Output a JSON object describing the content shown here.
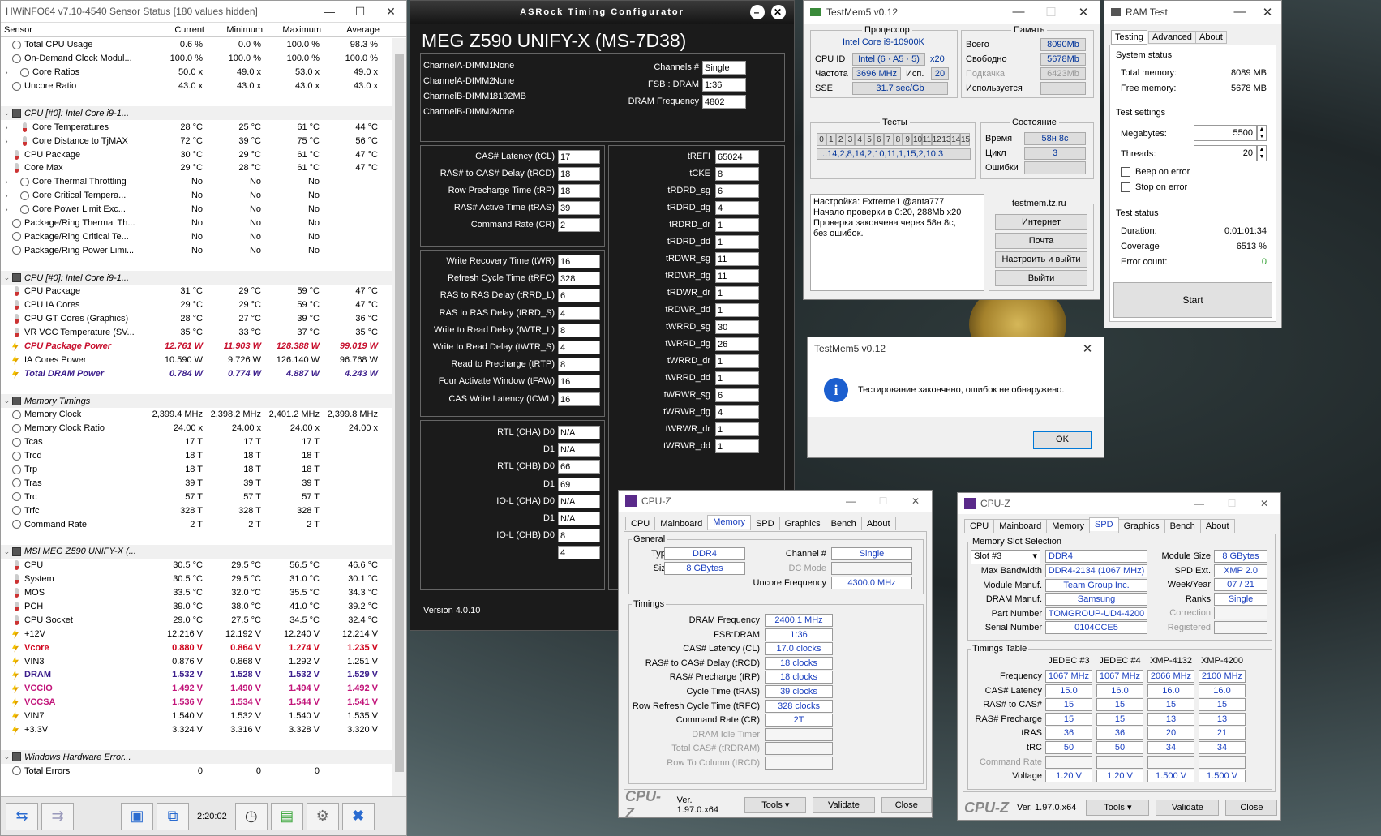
{
  "hwinfo": {
    "title": "HWiNFO64 v7.10-4540 Sensor Status [180 values hidden]",
    "headers": [
      "Sensor",
      "Current",
      "Minimum",
      "Maximum",
      "Average"
    ],
    "rows": [
      {
        "t": "c",
        "n": "Total CPU Usage",
        "v": [
          "0.6 %",
          "0.0 %",
          "100.0 %",
          "98.3 %"
        ]
      },
      {
        "t": "c",
        "n": "On-Demand Clock Modul...",
        "v": [
          "100.0 %",
          "100.0 %",
          "100.0 %",
          "100.0 %"
        ]
      },
      {
        "t": "c",
        "x": "›",
        "n": "Core Ratios",
        "v": [
          "50.0 x",
          "49.0 x",
          "53.0 x",
          "49.0 x"
        ],
        "ind": 1
      },
      {
        "t": "c",
        "n": "Uncore Ratio",
        "v": [
          "43.0 x",
          "43.0 x",
          "43.0 x",
          "43.0 x"
        ]
      },
      {
        "t": "blank"
      },
      {
        "t": "g",
        "x": "⌄",
        "n": "CPU [#0]: Intel Core i9-1..."
      },
      {
        "t": "th",
        "x": "›",
        "n": "Core Temperatures",
        "v": [
          "28 °C",
          "25 °C",
          "61 °C",
          "44 °C"
        ],
        "ind": 1
      },
      {
        "t": "th",
        "x": "›",
        "n": "Core Distance to TjMAX",
        "v": [
          "72 °C",
          "39 °C",
          "75 °C",
          "56 °C"
        ],
        "ind": 1
      },
      {
        "t": "th",
        "n": "CPU Package",
        "v": [
          "30 °C",
          "29 °C",
          "61 °C",
          "47 °C"
        ]
      },
      {
        "t": "th",
        "n": "Core Max",
        "v": [
          "29 °C",
          "28 °C",
          "61 °C",
          "47 °C"
        ]
      },
      {
        "t": "c",
        "x": "›",
        "n": "Core Thermal Throttling",
        "v": [
          "No",
          "No",
          "No",
          ""
        ],
        "ind": 1
      },
      {
        "t": "c",
        "x": "›",
        "n": "Core Critical Tempera...",
        "v": [
          "No",
          "No",
          "No",
          ""
        ],
        "ind": 1
      },
      {
        "t": "c",
        "x": "›",
        "n": "Core Power Limit Exc...",
        "v": [
          "No",
          "No",
          "No",
          ""
        ],
        "ind": 1
      },
      {
        "t": "c",
        "n": "Package/Ring Thermal Th...",
        "v": [
          "No",
          "No",
          "No",
          ""
        ]
      },
      {
        "t": "c",
        "n": "Package/Ring Critical Te...",
        "v": [
          "No",
          "No",
          "No",
          ""
        ]
      },
      {
        "t": "c",
        "n": "Package/Ring Power Limi...",
        "v": [
          "No",
          "No",
          "No",
          ""
        ]
      },
      {
        "t": "blank"
      },
      {
        "t": "g",
        "x": "⌄",
        "n": "CPU [#0]: Intel Core i9-1..."
      },
      {
        "t": "th",
        "n": "CPU Package",
        "v": [
          "31 °C",
          "29 °C",
          "59 °C",
          "47 °C"
        ]
      },
      {
        "t": "th",
        "n": "CPU IA Cores",
        "v": [
          "29 °C",
          "29 °C",
          "59 °C",
          "47 °C"
        ]
      },
      {
        "t": "th",
        "n": "CPU GT Cores (Graphics)",
        "v": [
          "28 °C",
          "27 °C",
          "39 °C",
          "36 °C"
        ]
      },
      {
        "t": "th",
        "n": "VR VCC Temperature (SV...",
        "v": [
          "35 °C",
          "33 °C",
          "37 °C",
          "35 °C"
        ]
      },
      {
        "t": "b",
        "cls": "red",
        "n": "CPU Package Power",
        "v": [
          "12.761 W",
          "11.903 W",
          "128.388 W",
          "99.019 W"
        ]
      },
      {
        "t": "b",
        "n": "IA Cores Power",
        "v": [
          "10.590 W",
          "9.726 W",
          "126.140 W",
          "96.768 W"
        ]
      },
      {
        "t": "b",
        "cls": "blue",
        "n": "Total DRAM Power",
        "v": [
          "0.784 W",
          "0.774 W",
          "4.887 W",
          "4.243 W"
        ]
      },
      {
        "t": "blank"
      },
      {
        "t": "g",
        "x": "⌄",
        "n": "Memory Timings"
      },
      {
        "t": "c",
        "n": "Memory Clock",
        "v": [
          "2,399.4 MHz",
          "2,398.2 MHz",
          "2,401.2 MHz",
          "2,399.8 MHz"
        ]
      },
      {
        "t": "c",
        "n": "Memory Clock Ratio",
        "v": [
          "24.00 x",
          "24.00 x",
          "24.00 x",
          "24.00 x"
        ]
      },
      {
        "t": "c",
        "n": "Tcas",
        "v": [
          "17 T",
          "17 T",
          "17 T",
          ""
        ]
      },
      {
        "t": "c",
        "n": "Trcd",
        "v": [
          "18 T",
          "18 T",
          "18 T",
          ""
        ]
      },
      {
        "t": "c",
        "n": "Trp",
        "v": [
          "18 T",
          "18 T",
          "18 T",
          ""
        ]
      },
      {
        "t": "c",
        "n": "Tras",
        "v": [
          "39 T",
          "39 T",
          "39 T",
          ""
        ]
      },
      {
        "t": "c",
        "n": "Trc",
        "v": [
          "57 T",
          "57 T",
          "57 T",
          ""
        ]
      },
      {
        "t": "c",
        "n": "Trfc",
        "v": [
          "328 T",
          "328 T",
          "328 T",
          ""
        ]
      },
      {
        "t": "c",
        "n": "Command Rate",
        "v": [
          "2 T",
          "2 T",
          "2 T",
          ""
        ]
      },
      {
        "t": "blank"
      },
      {
        "t": "g",
        "x": "⌄",
        "n": "MSI MEG Z590 UNIFY-X (..."
      },
      {
        "t": "th",
        "n": "CPU",
        "v": [
          "30.5 °C",
          "29.5 °C",
          "56.5 °C",
          "46.6 °C"
        ]
      },
      {
        "t": "th",
        "n": "System",
        "v": [
          "30.5 °C",
          "29.5 °C",
          "31.0 °C",
          "30.1 °C"
        ]
      },
      {
        "t": "th",
        "n": "MOS",
        "v": [
          "33.5 °C",
          "32.0 °C",
          "35.5 °C",
          "34.3 °C"
        ]
      },
      {
        "t": "th",
        "n": "PCH",
        "v": [
          "39.0 °C",
          "38.0 °C",
          "41.0 °C",
          "39.2 °C"
        ]
      },
      {
        "t": "th",
        "n": "CPU Socket",
        "v": [
          "29.0 °C",
          "27.5 °C",
          "34.5 °C",
          "32.4 °C"
        ]
      },
      {
        "t": "b",
        "n": "+12V",
        "v": [
          "12.216 V",
          "12.192 V",
          "12.240 V",
          "12.214 V"
        ]
      },
      {
        "t": "b",
        "cls": "vred",
        "n": "Vcore",
        "v": [
          "0.880 V",
          "0.864 V",
          "1.274 V",
          "1.235 V"
        ]
      },
      {
        "t": "b",
        "n": "VIN3",
        "v": [
          "0.876 V",
          "0.868 V",
          "1.292 V",
          "1.251 V"
        ]
      },
      {
        "t": "b",
        "cls": "dram",
        "n": "DRAM",
        "v": [
          "1.532 V",
          "1.528 V",
          "1.532 V",
          "1.529 V"
        ]
      },
      {
        "t": "b",
        "cls": "pink",
        "n": "VCCIO",
        "v": [
          "1.492 V",
          "1.490 V",
          "1.494 V",
          "1.492 V"
        ]
      },
      {
        "t": "b",
        "cls": "pink",
        "n": "VCCSA",
        "v": [
          "1.536 V",
          "1.534 V",
          "1.544 V",
          "1.541 V"
        ]
      },
      {
        "t": "b",
        "n": "VIN7",
        "v": [
          "1.540 V",
          "1.532 V",
          "1.540 V",
          "1.535 V"
        ]
      },
      {
        "t": "b",
        "n": "+3.3V",
        "v": [
          "3.324 V",
          "3.316 V",
          "3.328 V",
          "3.320 V"
        ]
      },
      {
        "t": "blank"
      },
      {
        "t": "g",
        "x": "⌄",
        "n": "Windows Hardware Error..."
      },
      {
        "t": "c",
        "n": "Total Errors",
        "v": [
          "0",
          "0",
          "0",
          ""
        ]
      }
    ],
    "time": "2:20:02"
  },
  "asrock": {
    "title": "ASRock Timing Configurator",
    "model": "MEG Z590 UNIFY-X (MS-7D38)",
    "dimms": [
      [
        "ChannelA-DIMM1",
        "None"
      ],
      [
        "ChannelA-DIMM2",
        "None"
      ],
      [
        "ChannelB-DIMM1",
        "8192MB"
      ],
      [
        "ChannelB-DIMM2",
        "None"
      ]
    ],
    "top": [
      [
        "Channels #",
        "Single"
      ],
      [
        "FSB : DRAM",
        "1:36"
      ],
      [
        "DRAM Frequency",
        "4802"
      ]
    ],
    "g1": [
      [
        "CAS# Latency (tCL)",
        "17"
      ],
      [
        "RAS# to CAS# Delay (tRCD)",
        "18"
      ],
      [
        "Row Precharge Time (tRP)",
        "18"
      ],
      [
        "RAS# Active Time (tRAS)",
        "39"
      ],
      [
        "Command Rate (CR)",
        "2"
      ]
    ],
    "g2": [
      [
        "Write Recovery Time (tWR)",
        "16"
      ],
      [
        "Refresh Cycle Time (tRFC)",
        "328"
      ],
      [
        "RAS to RAS Delay (tRRD_L)",
        "6"
      ],
      [
        "RAS to RAS Delay (tRRD_S)",
        "4"
      ],
      [
        "Write to Read Delay (tWTR_L)",
        "8"
      ],
      [
        "Write to Read Delay (tWTR_S)",
        "4"
      ],
      [
        "Read to Precharge (tRTP)",
        "8"
      ],
      [
        "Four Activate Window (tFAW)",
        "16"
      ],
      [
        "CAS Write Latency (tCWL)",
        "16"
      ]
    ],
    "g3": [
      [
        "RTL (CHA) D0",
        "N/A"
      ],
      [
        "D1",
        "N/A"
      ],
      [
        "RTL (CHB) D0",
        "66"
      ],
      [
        "D1",
        "69"
      ],
      [
        "IO-L (CHA) D0",
        "N/A"
      ],
      [
        "D1",
        "N/A"
      ],
      [
        "IO-L (CHB) D0",
        "8"
      ],
      [
        "",
        "4"
      ]
    ],
    "right": [
      [
        "tREFI",
        "65024"
      ],
      [
        "tCKE",
        "8"
      ],
      [
        "tRDRD_sg",
        "6"
      ],
      [
        "tRDRD_dg",
        "4"
      ],
      [
        "tRDRD_dr",
        "1"
      ],
      [
        "tRDRD_dd",
        "1"
      ],
      [
        "tRDWR_sg",
        "11"
      ],
      [
        "tRDWR_dg",
        "11"
      ],
      [
        "tRDWR_dr",
        "1"
      ],
      [
        "tRDWR_dd",
        "1"
      ],
      [
        "tWRRD_sg",
        "30"
      ],
      [
        "tWRRD_dg",
        "26"
      ],
      [
        "tWRRD_dr",
        "1"
      ],
      [
        "tWRRD_dd",
        "1"
      ],
      [
        "tWRWR_sg",
        "6"
      ],
      [
        "tWRWR_dg",
        "4"
      ],
      [
        "tWRWR_dr",
        "1"
      ],
      [
        "tWRWR_dd",
        "1"
      ]
    ],
    "version": "Version 4.0.10"
  },
  "tm5": {
    "title": "TestMem5 v0.12",
    "proc_h": "Процессор",
    "proc": "Intel Core i9-10900K",
    "cpuid_l": "CPU ID",
    "cpuid": "Intel (6 · A5 · 5)",
    "cpuid_x": "x20",
    "freq_l": "Частота",
    "freq": "3696 MHz",
    "isp_l": "Исп.",
    "isp": "20",
    "sse_l": "SSE",
    "sse": "31.7 sec/Gb",
    "mem_h": "Память",
    "mem": [
      [
        "Всего",
        "8090Mb",
        false
      ],
      [
        "Свободно",
        "5678Mb",
        false
      ],
      [
        "Подкачка",
        "6423Mb",
        true
      ],
      [
        "Используется",
        "",
        false
      ]
    ],
    "tests_h": "Тесты",
    "tests": [
      "0",
      "1",
      "2",
      "3",
      "4",
      "5",
      "6",
      "7",
      "8",
      "9",
      "10",
      "11",
      "12",
      "13",
      "14",
      "15"
    ],
    "seq": "...14,2,8,14,2,10,11,1,15,2,10,3",
    "state_h": "Состояние",
    "time_l": "Время",
    "time": "58н 8с",
    "cycle_l": "Цикл",
    "cycle": "3",
    "err_l": "Ошибки",
    "err": "",
    "log": [
      "Настройка: Extreme1 @anta777",
      "Начало проверки в 0:20, 288Mb x20",
      "Проверка закончена через 58н 8с,",
      "без ошибок."
    ],
    "site": "testmem.tz.ru",
    "buttons": [
      "Интернет",
      "Почта",
      "Настроить и выйти",
      "Выйти"
    ]
  },
  "dialog": {
    "title": "TestMem5 v0.12",
    "msg": "Тестирование закончено, ошибок не обнаружено.",
    "ok": "OK"
  },
  "ramtest": {
    "title": "RAM Test",
    "tabs": [
      "Testing",
      "Advanced",
      "About"
    ],
    "sys_h": "System status",
    "total_l": "Total memory:",
    "total": "8089 MB",
    "free_l": "Free memory:",
    "free": "5678 MB",
    "set_h": "Test settings",
    "mb_l": "Megabytes:",
    "mb": "5500",
    "th_l": "Threads:",
    "th": "20",
    "beep": "Beep on error",
    "stop": "Stop on error",
    "st_h": "Test status",
    "dur_l": "Duration:",
    "dur": "0:01:01:34",
    "cov_l": "Coverage",
    "cov": "6513 %",
    "ec_l": "Error count:",
    "ec": "0",
    "start": "Start"
  },
  "cpuz1": {
    "title": "CPU-Z",
    "tabs": [
      "CPU",
      "Mainboard",
      "Memory",
      "SPD",
      "Graphics",
      "Bench",
      "About"
    ],
    "active": 2,
    "general_h": "General",
    "type_l": "Type",
    "type": "DDR4",
    "size_l": "Size",
    "size": "8 GBytes",
    "chan_l": "Channel #",
    "chan": "Single",
    "dc_l": "DC Mode",
    "unc_l": "Uncore Frequency",
    "unc": "4300.0 MHz",
    "tim_h": "Timings",
    "timings": [
      [
        "DRAM Frequency",
        "2400.1 MHz",
        false
      ],
      [
        "FSB:DRAM",
        "1:36",
        false
      ],
      [
        "CAS# Latency (CL)",
        "17.0 clocks",
        false
      ],
      [
        "RAS# to CAS# Delay (tRCD)",
        "18 clocks",
        false
      ],
      [
        "RAS# Precharge (tRP)",
        "18 clocks",
        false
      ],
      [
        "Cycle Time (tRAS)",
        "39 clocks",
        false
      ],
      [
        "Row Refresh Cycle Time (tRFC)",
        "328 clocks",
        false
      ],
      [
        "Command Rate (CR)",
        "2T",
        false
      ],
      [
        "DRAM Idle Timer",
        "",
        true
      ],
      [
        "Total CAS# (tRDRAM)",
        "",
        true
      ],
      [
        "Row To Column (tRCD)",
        "",
        true
      ]
    ],
    "logo": "CPU-Z",
    "ver": "Ver. 1.97.0.x64",
    "tools": "Tools",
    "validate": "Validate",
    "close": "Close"
  },
  "cpuz2": {
    "title": "CPU-Z",
    "tabs": [
      "CPU",
      "Mainboard",
      "Memory",
      "SPD",
      "Graphics",
      "Bench",
      "About"
    ],
    "active": 3,
    "slot_h": "Memory Slot Selection",
    "slot": "Slot #3",
    "ddr": "DDR4",
    "left": [
      [
        "Max Bandwidth",
        "DDR4-2134 (1067 MHz)"
      ],
      [
        "Module Manuf.",
        "Team Group Inc."
      ],
      [
        "DRAM Manuf.",
        "Samsung"
      ],
      [
        "Part Number",
        "TOMGROUP-UD4-4200"
      ],
      [
        "Serial Number",
        "0104CCE5"
      ]
    ],
    "right": [
      [
        "Module Size",
        "8 GBytes",
        false
      ],
      [
        "SPD Ext.",
        "XMP 2.0",
        false
      ],
      [
        "Week/Year",
        "07 / 21",
        false
      ],
      [
        "Ranks",
        "Single",
        false
      ],
      [
        "Correction",
        "",
        true
      ],
      [
        "Registered",
        "",
        true
      ]
    ],
    "tt_h": "Timings Table",
    "cols": [
      "JEDEC #3",
      "JEDEC #4",
      "XMP-4132",
      "XMP-4200"
    ],
    "trows": [
      [
        "Frequency",
        [
          "1067 MHz",
          "1067 MHz",
          "2066 MHz",
          "2100 MHz"
        ],
        false
      ],
      [
        "CAS# Latency",
        [
          "15.0",
          "16.0",
          "16.0",
          "16.0"
        ],
        false
      ],
      [
        "RAS# to CAS#",
        [
          "15",
          "15",
          "15",
          "15"
        ],
        false
      ],
      [
        "RAS# Precharge",
        [
          "15",
          "15",
          "13",
          "13"
        ],
        false
      ],
      [
        "tRAS",
        [
          "36",
          "36",
          "20",
          "21"
        ],
        false
      ],
      [
        "tRC",
        [
          "50",
          "50",
          "34",
          "34"
        ],
        false
      ],
      [
        "Command Rate",
        [
          "",
          "",
          "",
          ""
        ],
        true
      ],
      [
        "Voltage",
        [
          "1.20 V",
          "1.20 V",
          "1.500 V",
          "1.500 V"
        ],
        false
      ]
    ],
    "logo": "CPU-Z",
    "ver": "Ver. 1.97.0.x64",
    "tools": "Tools",
    "validate": "Validate",
    "close": "Close"
  }
}
